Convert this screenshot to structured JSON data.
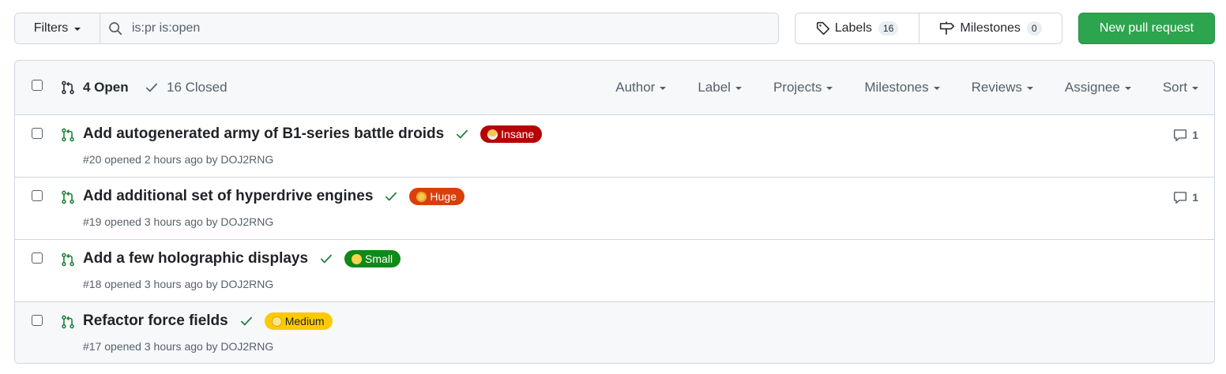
{
  "toolbar": {
    "filters_label": "Filters",
    "search_value": "is:pr is:open",
    "labels_label": "Labels",
    "labels_count": "16",
    "milestones_label": "Milestones",
    "milestones_count": "0",
    "new_pr_label": "New pull request"
  },
  "header": {
    "open_label": "4 Open",
    "closed_label": "16 Closed",
    "filters": [
      "Author",
      "Label",
      "Projects",
      "Milestones",
      "Reviews",
      "Assignee",
      "Sort"
    ]
  },
  "colors": {
    "success": "#1a7f37",
    "primary_button": "#2da44e",
    "label_insane": "#b60205",
    "label_huge": "#d93f0b",
    "label_small": "#0e8a16",
    "label_medium": "#fbca04"
  },
  "pull_requests": [
    {
      "title": "Add autogenerated army of B1-series battle droids",
      "label": "Insane",
      "label_icon": "exploding-head-emoji",
      "meta": "#20 opened 2 hours ago by DOJ2RNG",
      "comments": "1"
    },
    {
      "title": "Add additional set of hyperdrive engines",
      "label": "Huge",
      "label_icon": "astonished-face-emoji",
      "meta": "#19 opened 3 hours ago by DOJ2RNG",
      "comments": "1"
    },
    {
      "title": "Add a few holographic displays",
      "label": "Small",
      "label_icon": "yum-face-emoji",
      "meta": "#18 opened 3 hours ago by DOJ2RNG",
      "comments": ""
    },
    {
      "title": "Refactor force fields",
      "label": "Medium",
      "label_icon": "slightly-smiling-face-emoji",
      "meta": "#17 opened 3 hours ago by DOJ2RNG",
      "comments": ""
    }
  ]
}
